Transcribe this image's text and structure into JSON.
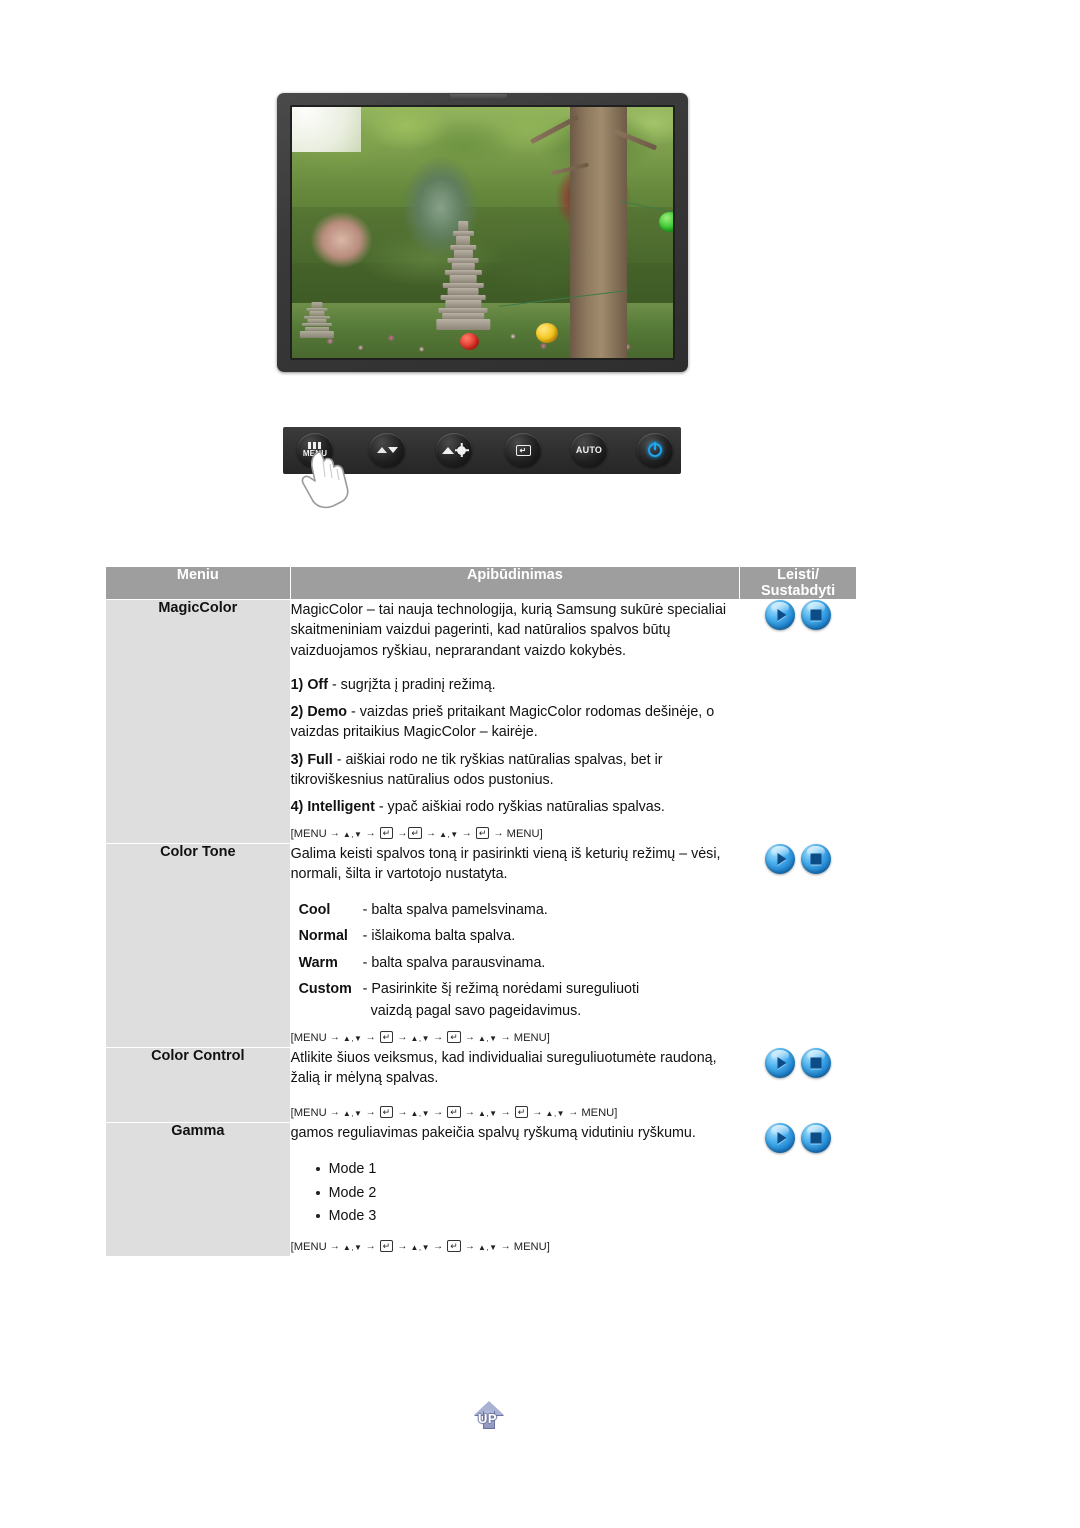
{
  "monitor": {
    "screen_image": "garden-photo-with-stone-pagoda",
    "panel_buttons": [
      {
        "name": "menu-button",
        "label": "MENU",
        "icon": "menu-bars-icon"
      },
      {
        "name": "down-button",
        "label": "",
        "icon": "hill-down-arrow-icon"
      },
      {
        "name": "brightness-button",
        "label": "",
        "icon": "hill-sun-icon"
      },
      {
        "name": "enter-button",
        "label": "",
        "icon": "enter-key-icon"
      },
      {
        "name": "auto-button",
        "label": "AUTO",
        "icon": "auto-text-icon"
      },
      {
        "name": "power-button",
        "label": "",
        "icon": "power-icon"
      }
    ]
  },
  "table": {
    "headers": {
      "menu": "Meniu",
      "description": "Apibūdinimas",
      "play_stop_line1": "Leisti/",
      "play_stop_line2": "Sustabdyti"
    },
    "rows": [
      {
        "menu": "MagicColor",
        "intro": "MagicColor – tai nauja technologija, kurią Samsung sukūrė specialiai skaitmeniniam vaizdui pagerinti, kad natūralios spalvos būtų vaizduojamos ryškiau, neprarandant vaizdo kokybės.",
        "items": [
          {
            "num": "1)",
            "term": "Off",
            "text": "- sugrįžta į pradinį režimą."
          },
          {
            "num": "2)",
            "term": "Demo",
            "text": "- vaizdas prieš pritaikant MagicColor rodomas dešinėje, o vaizdas pritaikius MagicColor – kairėje."
          },
          {
            "num": "3)",
            "term": "Full",
            "text": "- aiškiai rodo ne tik ryškias natūralias spalvas, bet ir tikroviškesnius natūralius odos pustonius."
          },
          {
            "num": "4)",
            "term": "Intelligent",
            "text": "- ypač aiškiai rodo ryškias natūralias spalvas."
          }
        ],
        "sequence": {
          "open": "[MENU",
          "steps": [
            "updown",
            "enter",
            "enter",
            "updown",
            "enter"
          ],
          "close": "MENU]"
        },
        "play_label": "play-icon",
        "stop_label": "stop-icon"
      },
      {
        "menu": "Color Tone",
        "intro": "Galima keisti spalvos toną ir pasirinkti vieną iš keturių režimų – vėsi, normali, šilta ir vartotojo nustatyta.",
        "tones": [
          {
            "term": "Cool",
            "def": "- balta spalva pamelsvinama."
          },
          {
            "term": "Normal",
            "def": "- išlaikoma balta spalva."
          },
          {
            "term": "Warm",
            "def": "- balta spalva parausvinama."
          },
          {
            "term": "Custom",
            "def": "- Pasirinkite šį režimą norėdami sureguliuoti",
            "def2": "vaizdą pagal savo pageidavimus."
          }
        ],
        "sequence": {
          "open": "[MENU",
          "steps": [
            "updown",
            "enter",
            "updown",
            "enter",
            "updown"
          ],
          "close": "MENU]"
        },
        "play_label": "play-icon",
        "stop_label": "stop-icon"
      },
      {
        "menu": "Color Control",
        "intro": "Atlikite šiuos veiksmus, kad individualiai sureguliuotumėte raudoną, žalią ir mėlyną spalvas.",
        "sequence": {
          "open": "[MENU",
          "steps": [
            "updown",
            "enter",
            "updown",
            "enter",
            "updown",
            "enter",
            "updown"
          ],
          "close": "MENU]"
        },
        "play_label": "play-icon",
        "stop_label": "stop-icon"
      },
      {
        "menu": "Gamma",
        "intro": "gamos reguliavimas pakeičia spalvų ryškumą vidutiniu ryškumu.",
        "modes": [
          "Mode 1",
          "Mode 2",
          "Mode 3"
        ],
        "sequence": {
          "open": "[MENU",
          "steps": [
            "updown",
            "enter",
            "updown",
            "enter",
            "updown"
          ],
          "close": "MENU]"
        },
        "play_label": "play-icon",
        "stop_label": "stop-icon"
      }
    ]
  },
  "up_button": {
    "label": "UP"
  },
  "colors": {
    "header_bg": "#9e9e9e",
    "menu_cell_bg": "#dedede",
    "table_border": "#a8a8a8",
    "button_blue": "#1b7ecb",
    "power_blue": "#1ea6f0"
  }
}
